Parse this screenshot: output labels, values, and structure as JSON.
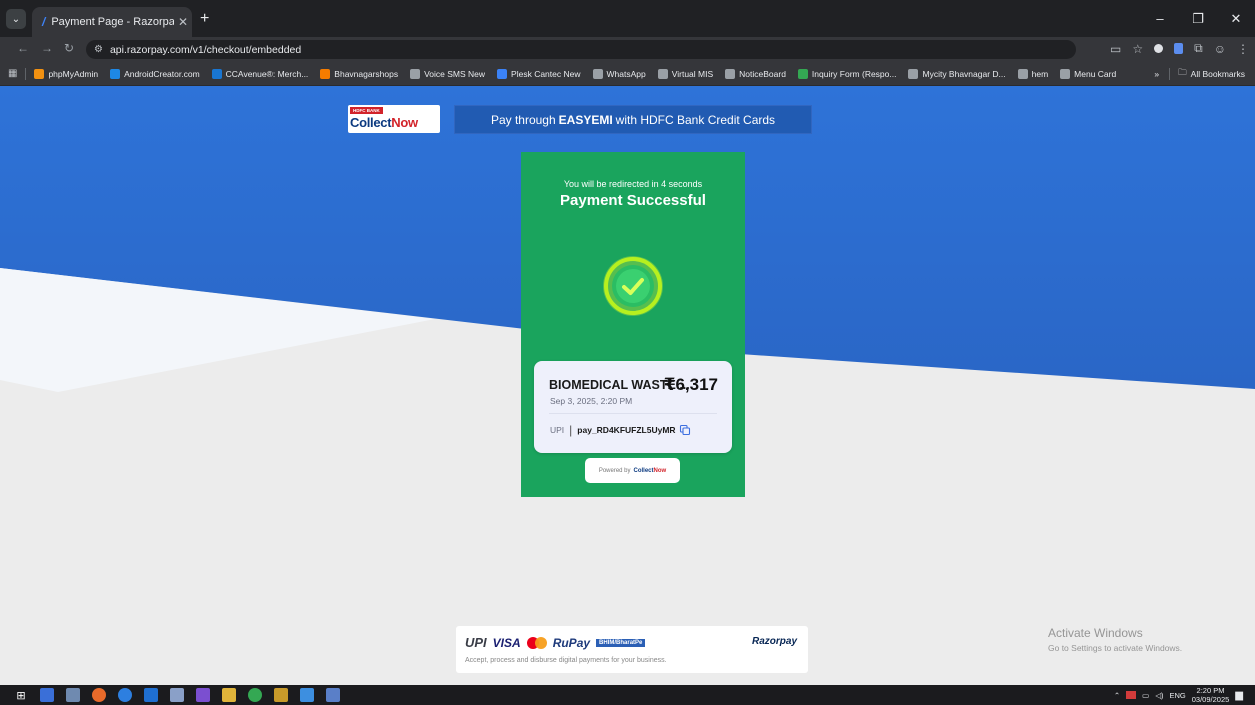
{
  "browser": {
    "tab_title": "Payment Page - Razorpay",
    "url": "api.razorpay.com/v1/checkout/embedded",
    "bookmarks": [
      {
        "label": "phpMyAdmin",
        "color": "#f29111",
        "icon": "php-icon"
      },
      {
        "label": "AndroidCreator.com",
        "color": "#1e88e5",
        "icon": "android-creator-icon"
      },
      {
        "label": "CCAvenue®: Merch...",
        "color": "#1976d2",
        "icon": "ccavenue-icon"
      },
      {
        "label": "Bhavnagarshops",
        "color": "#f57c00",
        "icon": "bhavnagarshops-icon"
      },
      {
        "label": "Voice SMS New",
        "color": "#9aa0a6",
        "icon": "globe-icon"
      },
      {
        "label": "Plesk Cantec New",
        "color": "#3b82f6",
        "icon": "plesk-icon"
      },
      {
        "label": "WhatsApp",
        "color": "#9aa0a6",
        "icon": "globe-icon"
      },
      {
        "label": "Virtual MIS",
        "color": "#9aa0a6",
        "icon": "globe-icon"
      },
      {
        "label": "NoticeBoard",
        "color": "#9aa0a6",
        "icon": "globe-icon"
      },
      {
        "label": "Inquiry Form (Respo...",
        "color": "#34a853",
        "icon": "forms-icon"
      },
      {
        "label": "Mycity Bhavnagar D...",
        "color": "#9aa0a6",
        "icon": "globe-icon"
      },
      {
        "label": "hem",
        "color": "#9aa0a6",
        "icon": "chatgpt-icon"
      },
      {
        "label": "Menu Card",
        "color": "#9aa0a6",
        "icon": "chatgpt-icon"
      }
    ],
    "all_bookmarks_label": "All Bookmarks"
  },
  "header": {
    "hdfc_tag": "HDFC BANK",
    "brand_collect": "Collect",
    "brand_now": "Now",
    "banner_before": "Pay through",
    "banner_bold": "EASYEMI",
    "banner_after": "with HDFC Bank Credit Cards"
  },
  "status": {
    "redirect_text": "You will be redirected in 4 seconds",
    "title": "Payment Successful"
  },
  "payment": {
    "merchant": "BIOMEDICAL WASTE ...",
    "amount": "₹6,317",
    "datetime": "Sep 3, 2025, 2:20 PM",
    "method": "UPI",
    "payment_id": "pay_RD4KFUFZL5UyMR"
  },
  "powered_by": {
    "label": "Powered by",
    "brand_collect": "Collect",
    "brand_now": "Now"
  },
  "footer": {
    "logos": {
      "upi": "UPI",
      "visa": "VISA",
      "rupay": "RuPay",
      "bharat": "BHIM/BharatPe"
    },
    "razorpay": "Razorpay",
    "tagline": "Accept, process and disburse digital payments for your business."
  },
  "watermark": {
    "line1": "Activate Windows",
    "line2": "Go to Settings to activate Windows."
  },
  "taskbar": {
    "lang": "ENG",
    "time": "2:20 PM",
    "date": "03/09/2025"
  },
  "colors": {
    "success_green": "#1aa45d",
    "check_ring": "#b7f01f",
    "bg_blue": "#2b6fd6"
  }
}
